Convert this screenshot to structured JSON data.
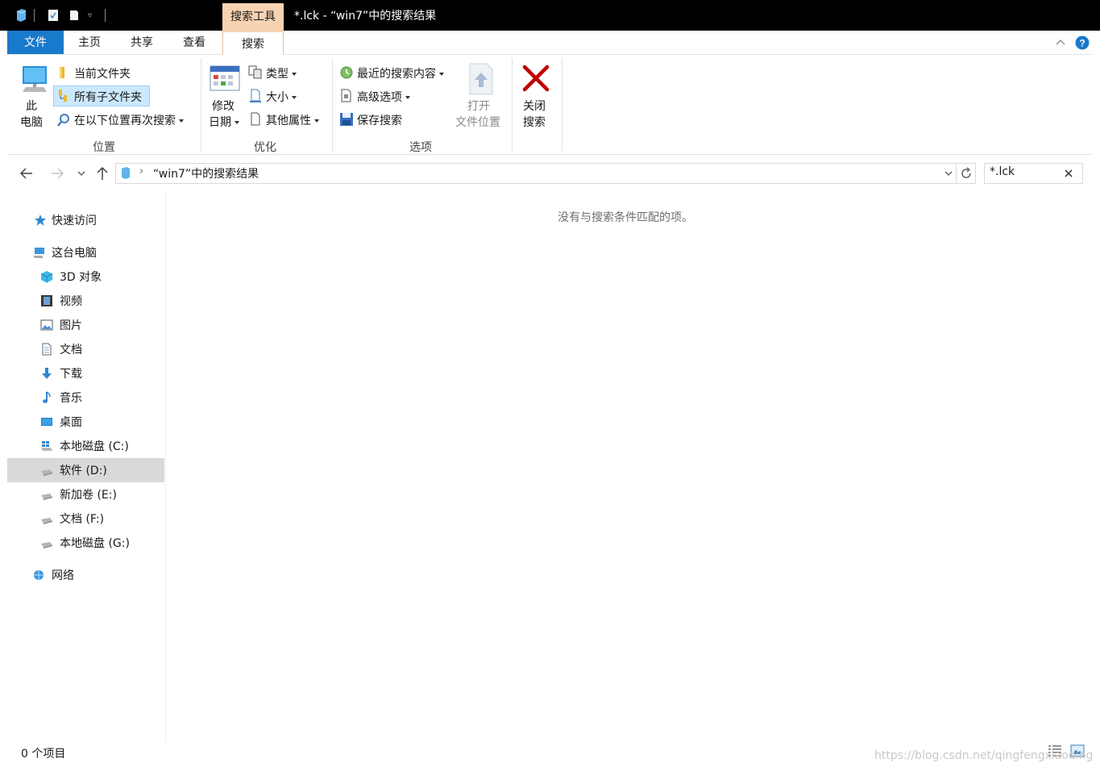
{
  "titlebar": {
    "context_tab": "搜索工具",
    "title": "*.lck - “win7”中的搜索结果"
  },
  "tabs": [
    {
      "label": "文件"
    },
    {
      "label": "主页"
    },
    {
      "label": "共享"
    },
    {
      "label": "查看"
    },
    {
      "label": "搜索"
    }
  ],
  "ribbon": {
    "location": {
      "this_pc_line1": "此",
      "this_pc_line2": "电脑",
      "current_folder": "当前文件夹",
      "all_subfolders": "所有子文件夹",
      "search_again": "在以下位置再次搜索",
      "group_label": "位置"
    },
    "refine": {
      "date_modified_line1": "修改",
      "date_modified_line2": "日期",
      "kind": "类型",
      "size": "大小",
      "other_props": "其他属性",
      "group_label": "优化"
    },
    "options": {
      "recent_searches": "最近的搜索内容",
      "advanced_options": "高级选项",
      "save_search": "保存搜索",
      "open_location_line1": "打开",
      "open_location_line2": "文件位置",
      "group_label": "选项"
    },
    "close": {
      "line1": "关闭",
      "line2": "搜索"
    }
  },
  "address": {
    "path": "“win7”中的搜索结果"
  },
  "search": {
    "value": "*.lck"
  },
  "navpane": {
    "quick_access": "快速访问",
    "this_pc": "这台电脑",
    "items": [
      {
        "label": "3D 对象",
        "icon": "3d-objects-icon"
      },
      {
        "label": "视频",
        "icon": "videos-icon"
      },
      {
        "label": "图片",
        "icon": "pictures-icon"
      },
      {
        "label": "文档",
        "icon": "documents-icon"
      },
      {
        "label": "下载",
        "icon": "downloads-icon"
      },
      {
        "label": "音乐",
        "icon": "music-icon"
      },
      {
        "label": "桌面",
        "icon": "desktop-icon"
      },
      {
        "label": "本地磁盘 (C:)",
        "icon": "system-drive-icon"
      },
      {
        "label": "软件 (D:)",
        "icon": "drive-icon"
      },
      {
        "label": "新加卷 (E:)",
        "icon": "drive-icon"
      },
      {
        "label": "文档 (F:)",
        "icon": "drive-icon"
      },
      {
        "label": "本地磁盘 (G:)",
        "icon": "drive-icon"
      }
    ],
    "network": "网络"
  },
  "content": {
    "empty_message": "没有与搜索条件匹配的项。"
  },
  "status": {
    "item_count": "0 个项目"
  },
  "watermark": "https://blog.csdn.net/qingfengxiaoding",
  "colors": {
    "file_tab": "#1979ca",
    "context_tab": "#f7d3b2",
    "selected_row": "#d9d9d9",
    "close_x": "#c00000",
    "help": "#1979ca"
  }
}
